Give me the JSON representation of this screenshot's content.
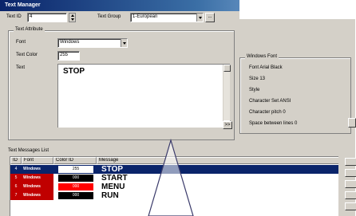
{
  "window": {
    "title": "Text Manager"
  },
  "top": {
    "text_id_label": "Text ID",
    "text_id_value": "4",
    "text_group_label": "Text Group",
    "text_group_value": "1-European",
    "more_button": "..."
  },
  "text_attribute": {
    "group_label": "Text Attribute",
    "font_label": "Font",
    "font_value": "Windows",
    "color_label": "Text Color",
    "color_value": "255",
    "text_label": "Text",
    "text_value": "STOP",
    "expand_button": ">>"
  },
  "windows_font": {
    "group_label": "Windows Font",
    "lines": [
      "Font    Arial Black",
      "Size    13",
      "Style",
      "Character Set    ANSI",
      "Character pitch    0",
      "Space between lines    0"
    ]
  },
  "list": {
    "label": "Text Messages List",
    "headers": [
      "ID",
      "Font",
      "Color ID",
      "Message"
    ],
    "rows": [
      {
        "id": "4",
        "font": "Windows",
        "color_id": "255",
        "message": "STOP",
        "swatch": "#ffffff",
        "swatch_text": "#000000",
        "selected": true
      },
      {
        "id": "5",
        "font": "Windows",
        "color_id": "000",
        "message": "START",
        "swatch": "#000000",
        "swatch_text": "#ffffff",
        "selected": false
      },
      {
        "id": "6",
        "font": "Windows",
        "color_id": "000",
        "message": "MENU",
        "swatch": "#ff0000",
        "swatch_text": "#ffffff",
        "selected": false
      },
      {
        "id": "7",
        "font": "Windows",
        "color_id": "000",
        "message": "RUN",
        "swatch": "#000000",
        "swatch_text": "#ffffff",
        "selected": false
      }
    ]
  },
  "colors": {
    "title_start": "#0a246a",
    "title_end": "#a6caf0",
    "selection": "#0a246a",
    "face": "#d4d0c8"
  }
}
